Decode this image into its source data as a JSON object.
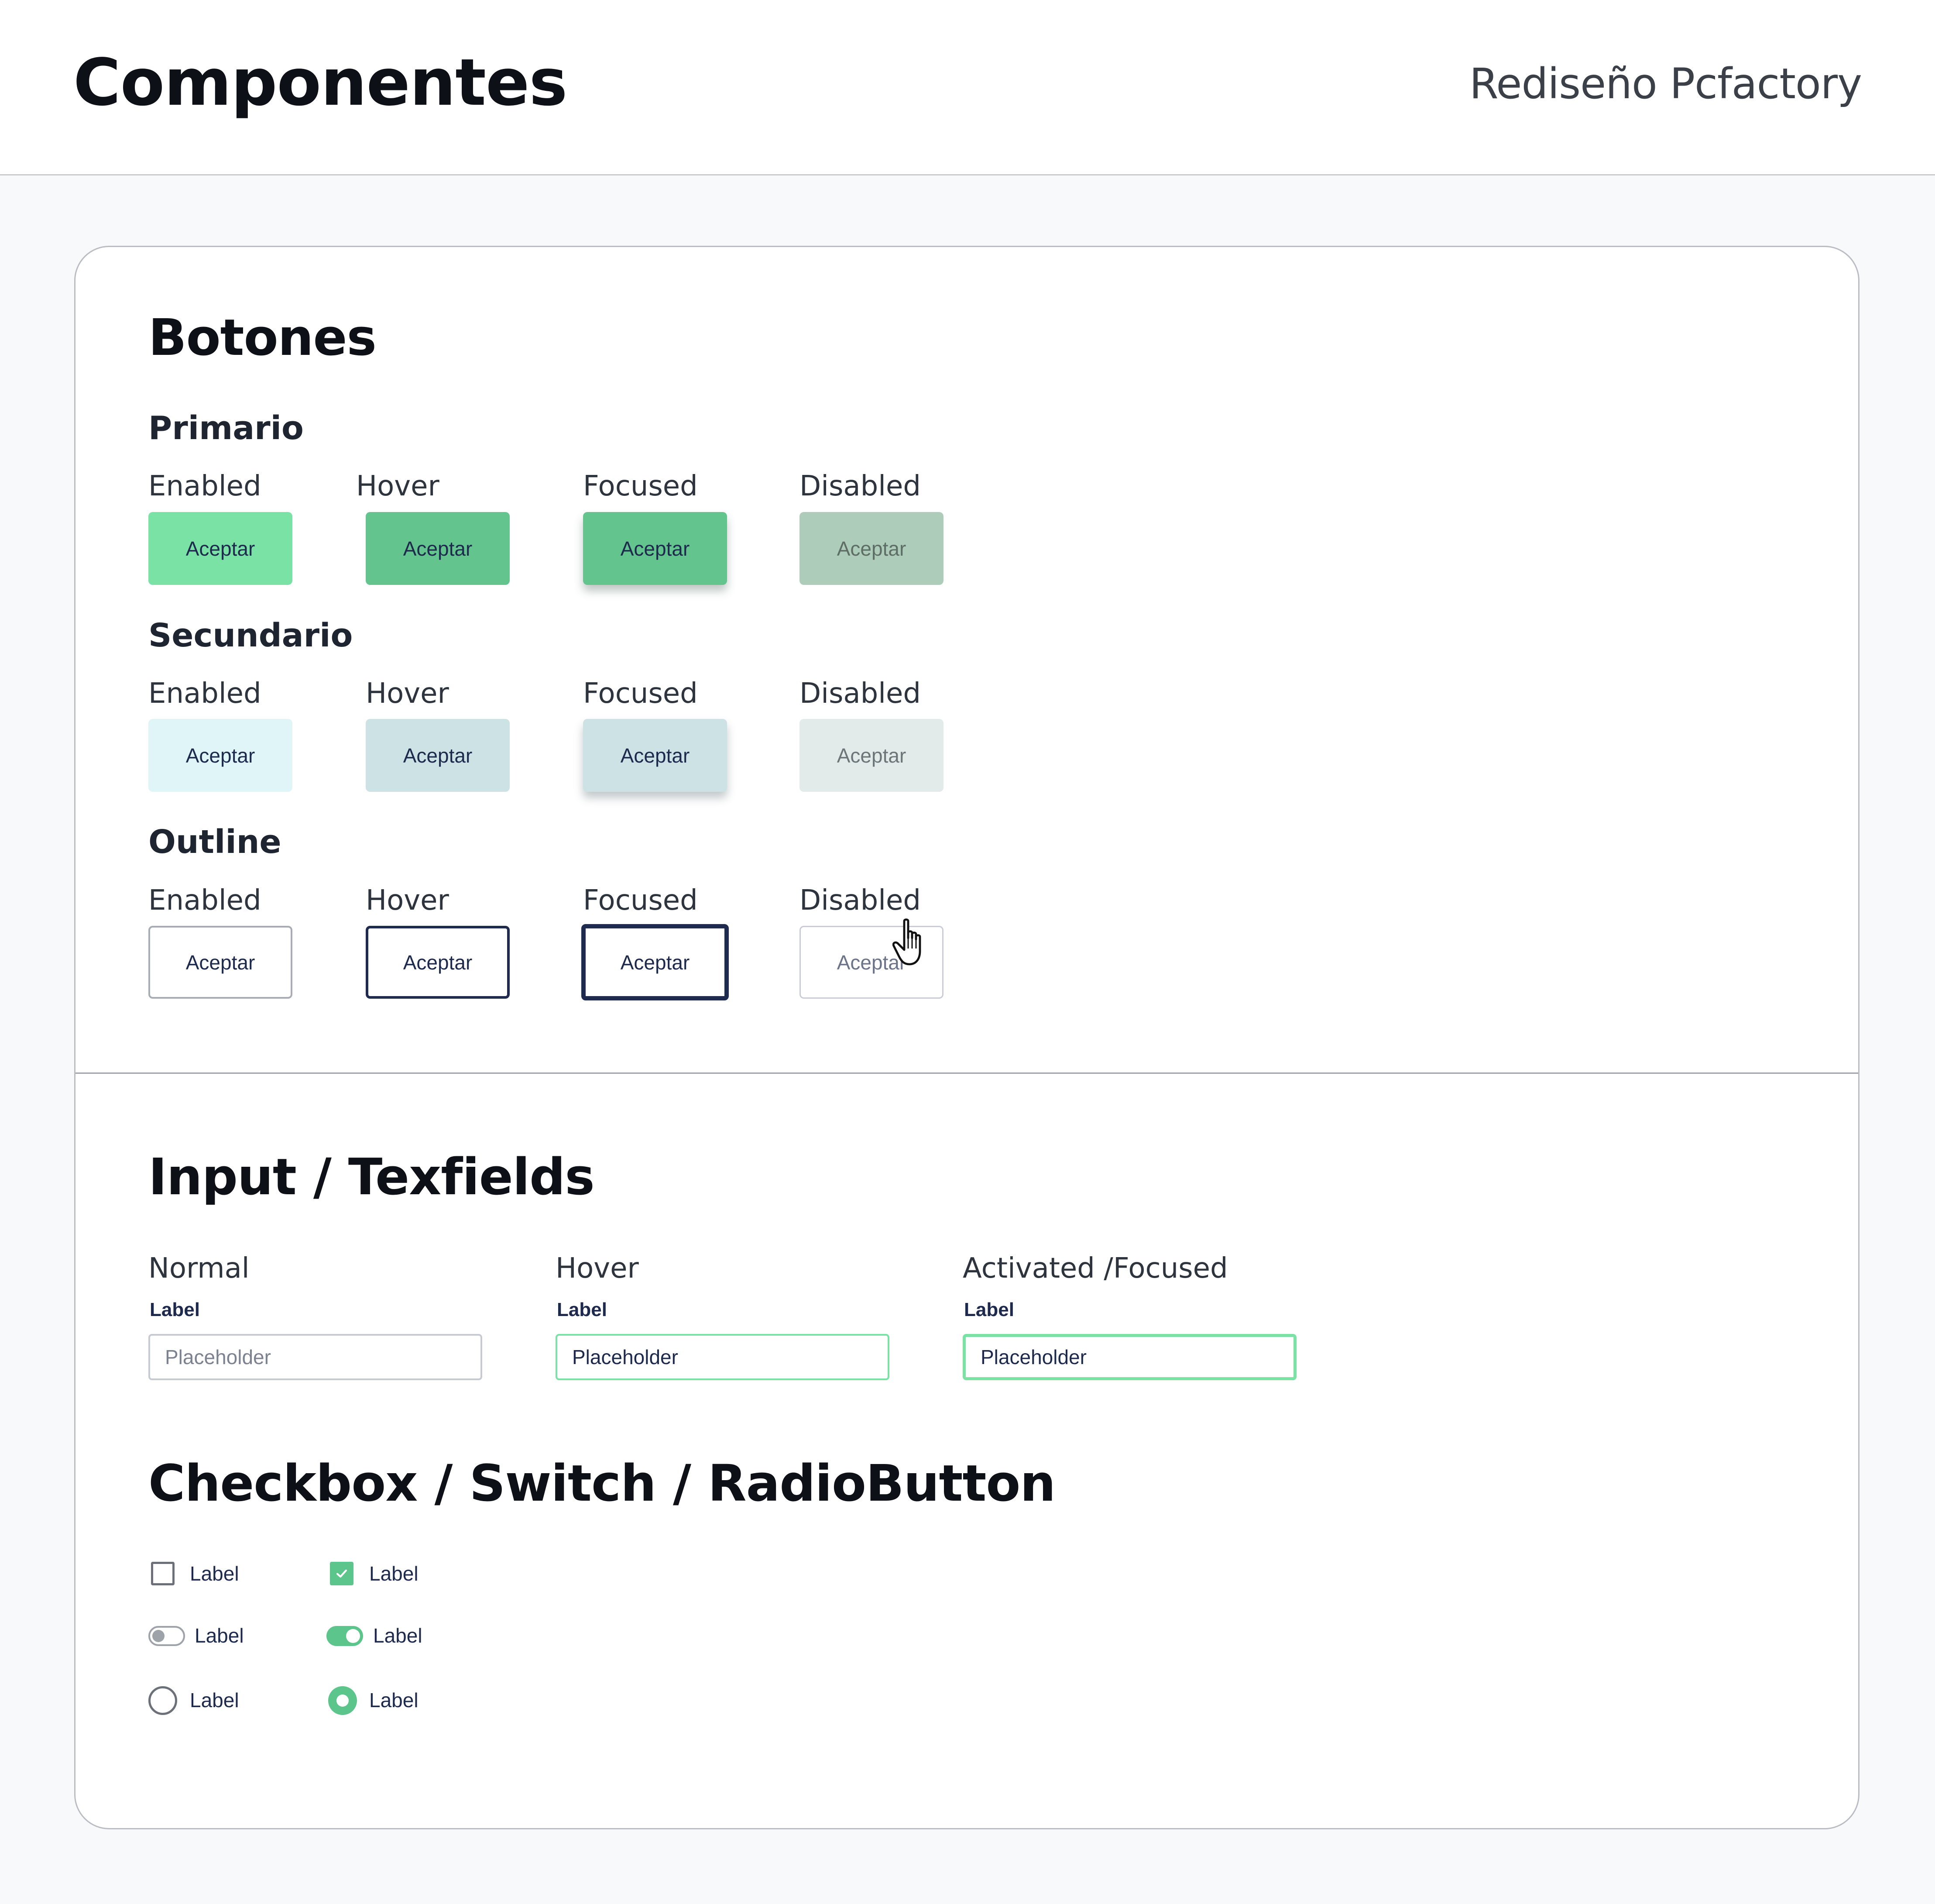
{
  "header": {
    "title": "Componentes",
    "project": "Rediseño Pcfactory"
  },
  "buttons": {
    "title": "Botones",
    "button_label": "Aceptar",
    "groups": [
      {
        "title": "Primario",
        "states": [
          "Enabled",
          "Hover",
          "Focused",
          "Disabled"
        ]
      },
      {
        "title": "Secundario",
        "states": [
          "Enabled",
          "Hover",
          "Focused",
          "Disabled"
        ]
      },
      {
        "title": "Outline",
        "states": [
          "Enabled",
          "Hover",
          "Focused",
          "Disabled"
        ]
      }
    ]
  },
  "inputs": {
    "title": "Input / Texfields",
    "fields": [
      {
        "state": "Normal",
        "label": "Label",
        "placeholder": "Placeholder"
      },
      {
        "state": "Hover",
        "label": "Label",
        "placeholder": "Placeholder"
      },
      {
        "state": "Activated /Focused",
        "label": "Label",
        "placeholder": "Placeholder"
      }
    ]
  },
  "controls": {
    "title": "Checkbox / Switch / RadioButton",
    "checkbox": [
      {
        "label": "Label",
        "checked": false
      },
      {
        "label": "Label",
        "checked": true
      }
    ],
    "switch": [
      {
        "label": "Label",
        "on": false
      },
      {
        "label": "Label",
        "on": true
      }
    ],
    "radio": [
      {
        "label": "Label",
        "selected": false
      },
      {
        "label": "Label",
        "selected": true
      }
    ]
  },
  "colors": {
    "primary": "#7ae2a4",
    "primary_hover": "#63c48d",
    "secondary": "#e0f5f7",
    "outline_dark": "#1e2b4f",
    "text_dark": "#1d2a4d"
  },
  "icons": [
    "hand-cursor-icon",
    "checkmark-icon"
  ]
}
